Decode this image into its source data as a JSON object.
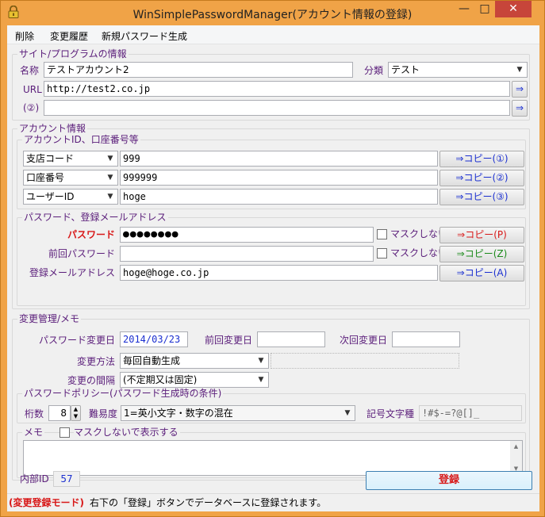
{
  "window": {
    "title": "WinSimplePasswordManager(アカウント情報の登録)",
    "minimize": "—",
    "maximize": "□",
    "close": "✕"
  },
  "menu": [
    "削除",
    "変更履歴",
    "新規パスワード生成"
  ],
  "site": {
    "group_label": "サイト/プログラムの情報",
    "name_label": "名称",
    "name_value": "テストアカウント2",
    "category_label": "分類",
    "category_value": "テスト",
    "url_label": "URL",
    "url_value": "http://test2.co.jp",
    "url2_label": "(②)",
    "url2_value": "",
    "open_arrow": "⇒"
  },
  "account": {
    "group_label": "アカウント情報",
    "ids_label": "アカウントID、口座番号等",
    "rows": [
      {
        "type": "支店コード",
        "value": "999",
        "copy": "⇒コピー(①)"
      },
      {
        "type": "口座番号",
        "value": "999999",
        "copy": "⇒コピー(②)"
      },
      {
        "type": "ユーザーID",
        "value": "hoge",
        "copy": "⇒コピー(③)"
      }
    ],
    "pw_group_label": "パスワード、登録メールアドレス",
    "password_label": "パスワード",
    "password_value": "●●●●●●●●",
    "nomask_label": "マスクしない",
    "password_copy": "⇒コピー(P)",
    "prev_password_label": "前回パスワード",
    "prev_password_value": "",
    "prev_nomask_label": "マスクしない",
    "prev_copy": "⇒コピー(Z)",
    "email_label": "登録メールアドレス",
    "email_value": "hoge@hoge.co.jp",
    "email_copy": "⇒コピー(A)"
  },
  "change": {
    "group_label": "変更管理/メモ",
    "pw_changed_label": "パスワード変更日",
    "pw_changed_value": "2014/03/23",
    "prev_changed_label": "前回変更日",
    "prev_changed_value": "",
    "next_changed_label": "次回変更日",
    "next_changed_value": "",
    "method_label": "変更方法",
    "method_value": "毎回自動生成",
    "method_extra": "",
    "interval_label": "変更の間隔",
    "interval_value": "(不定期又は固定)",
    "policy_label": "パスワードポリシー(パスワード生成時の条件)",
    "digits_label": "桁数",
    "digits_value": "8",
    "difficulty_label": "難易度",
    "difficulty_value": "1=英小文字・数字の混在",
    "symbols_label": "記号文字種",
    "symbols_value": "!#$-=?@[]_"
  },
  "memo": {
    "group_label": "メモ",
    "show_label": "マスクしないで表示する",
    "value": ""
  },
  "footer": {
    "internal_id_label": "内部ID",
    "internal_id_value": "57",
    "register_button": "登録"
  },
  "status": {
    "mode": "(変更登録モード)",
    "message": "右下の「登録」ボタンでデータベースに登録されます。"
  },
  "colors": {
    "title_bar": "#f0a347",
    "label_purple": "#5a1d7a",
    "red_accent": "#d81818",
    "blue_accent": "#1b2fd0",
    "green_accent": "#1c8a1c"
  }
}
